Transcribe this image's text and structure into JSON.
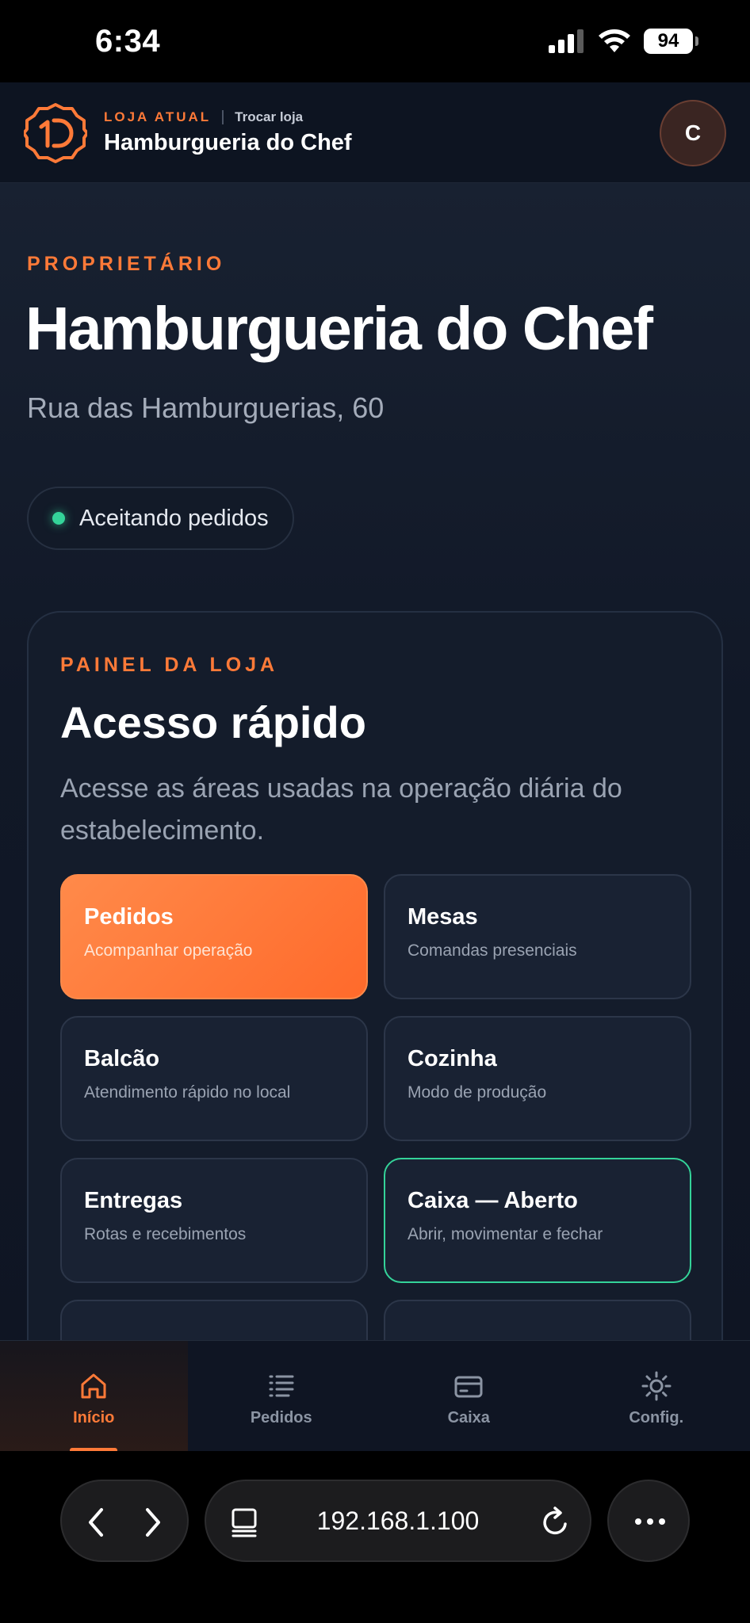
{
  "status_bar": {
    "time": "6:34",
    "battery": "94"
  },
  "header": {
    "current_label": "LOJA ATUAL",
    "switch_label": "Trocar loja",
    "store_name": "Hamburgueria do Chef",
    "avatar_initial": "C"
  },
  "main": {
    "role": "PROPRIETÁRIO",
    "title": "Hamburgueria do Chef",
    "address": "Rua das Hamburguerias, 60",
    "status": "Aceitando pedidos"
  },
  "panel": {
    "eyebrow": "PAINEL DA LOJA",
    "title": "Acesso rápido",
    "description": "Acesse as áreas usadas na operação diária do estabelecimento.",
    "tiles": [
      {
        "title": "Pedidos",
        "subtitle": "Acompanhar operação"
      },
      {
        "title": "Mesas",
        "subtitle": "Comandas presenciais"
      },
      {
        "title": "Balcão",
        "subtitle": "Atendimento rápido no local"
      },
      {
        "title": "Cozinha",
        "subtitle": "Modo de produção"
      },
      {
        "title": "Entregas",
        "subtitle": "Rotas e recebimentos"
      },
      {
        "title": "Caixa — Aberto",
        "subtitle": "Abrir, movimentar e fechar"
      }
    ]
  },
  "bottom_nav": {
    "items": [
      {
        "label": "Início",
        "icon": "home-icon"
      },
      {
        "label": "Pedidos",
        "icon": "list-icon"
      },
      {
        "label": "Caixa",
        "icon": "card-icon"
      },
      {
        "label": "Config.",
        "icon": "gear-icon"
      }
    ]
  },
  "browser": {
    "url": "192.168.1.100"
  },
  "colors": {
    "accent": "#ff7a38",
    "success": "#34d399",
    "background": "#111827"
  }
}
